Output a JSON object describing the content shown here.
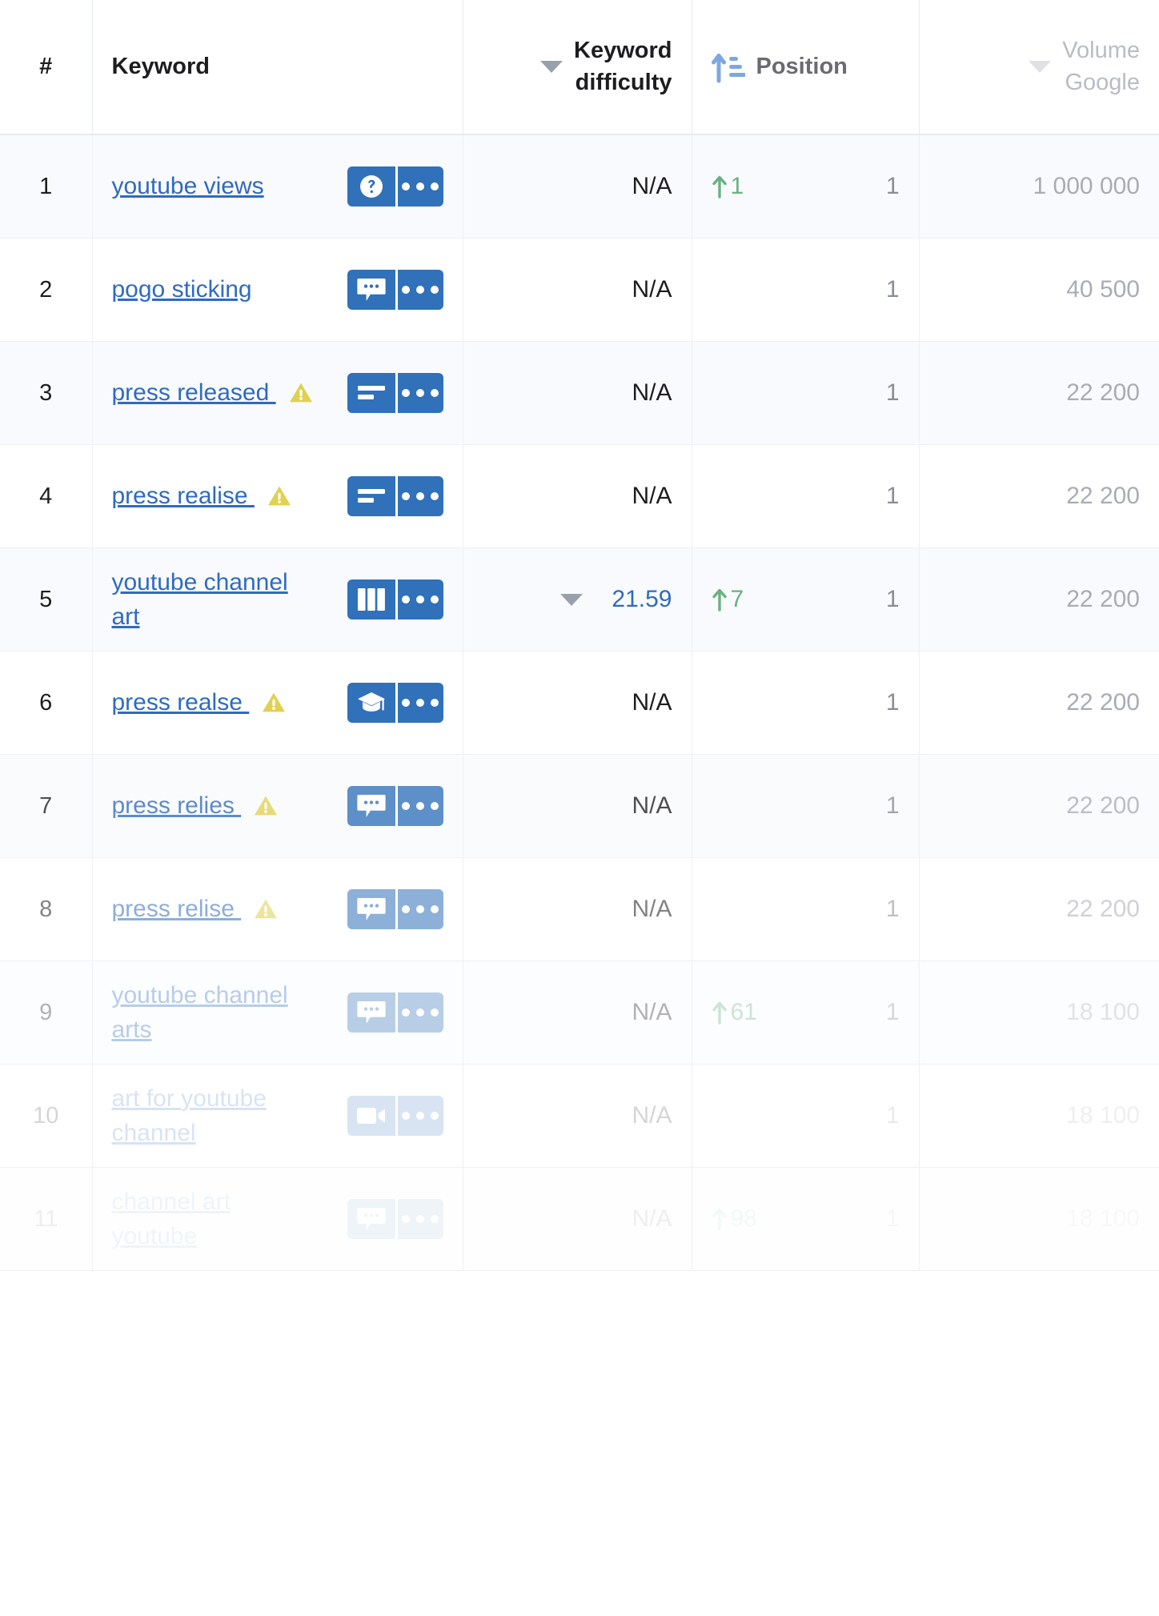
{
  "header": {
    "num_label": "#",
    "keyword_label": "Keyword",
    "kd_label_line1": "Keyword",
    "kd_label_line2": "difficulty",
    "position_label": "Position",
    "volume_label_line1": "Volume",
    "volume_label_line2": "Google",
    "kd_sort_icon": "caret-down-icon",
    "position_sort_icon": "sort-ascending-icon",
    "volume_sort_icon": "caret-down-icon"
  },
  "colors": {
    "link_blue": "#2f6bbf",
    "pill_blue": "#3071b9",
    "warning_yellow": "#e0d152",
    "up_green": "#6ab17f",
    "muted_gray": "#a9acb4",
    "row_alt": "#f9fafd",
    "border": "#eef0f6"
  },
  "rows": [
    {
      "num": "1",
      "keyword": "youtube views",
      "has_warning": false,
      "icon": "question-mark-icon",
      "menu_icon": "ellipsis-icon",
      "difficulty": "N/A",
      "difficulty_has_caret": false,
      "position_delta": "1",
      "position_delta_icon": "arrow-up-icon",
      "position": "1",
      "volume": "1 000 000"
    },
    {
      "num": "2",
      "keyword": "pogo sticking",
      "has_warning": false,
      "icon": "chat-bubble-icon",
      "menu_icon": "ellipsis-icon",
      "difficulty": "N/A",
      "difficulty_has_caret": false,
      "position_delta": "",
      "position_delta_icon": "",
      "position": "1",
      "volume": "40 500"
    },
    {
      "num": "3",
      "keyword": "press released",
      "has_warning": true,
      "icon": "text-lines-icon",
      "menu_icon": "ellipsis-icon",
      "difficulty": "N/A",
      "difficulty_has_caret": false,
      "position_delta": "",
      "position_delta_icon": "",
      "position": "1",
      "volume": "22 200"
    },
    {
      "num": "4",
      "keyword": "press realise",
      "has_warning": true,
      "icon": "text-lines-icon",
      "menu_icon": "ellipsis-icon",
      "difficulty": "N/A",
      "difficulty_has_caret": false,
      "position_delta": "",
      "position_delta_icon": "",
      "position": "1",
      "volume": "22 200"
    },
    {
      "num": "5",
      "keyword": "youtube channel art",
      "has_warning": false,
      "icon": "columns-icon",
      "menu_icon": "ellipsis-icon",
      "difficulty": "21.59",
      "difficulty_has_caret": true,
      "position_delta": "7",
      "position_delta_icon": "arrow-up-icon",
      "position": "1",
      "volume": "22 200"
    },
    {
      "num": "6",
      "keyword": "press realse",
      "has_warning": true,
      "icon": "graduation-cap-icon",
      "menu_icon": "ellipsis-icon",
      "difficulty": "N/A",
      "difficulty_has_caret": false,
      "position_delta": "",
      "position_delta_icon": "",
      "position": "1",
      "volume": "22 200"
    },
    {
      "num": "7",
      "keyword": "press relies",
      "has_warning": true,
      "icon": "chat-bubble-icon",
      "menu_icon": "ellipsis-icon",
      "difficulty": "N/A",
      "difficulty_has_caret": false,
      "position_delta": "",
      "position_delta_icon": "",
      "position": "1",
      "volume": "22 200"
    },
    {
      "num": "8",
      "keyword": "press relise",
      "has_warning": true,
      "icon": "chat-bubble-icon",
      "menu_icon": "ellipsis-icon",
      "difficulty": "N/A",
      "difficulty_has_caret": false,
      "position_delta": "",
      "position_delta_icon": "",
      "position": "1",
      "volume": "22 200"
    },
    {
      "num": "9",
      "keyword": "youtube channel arts",
      "has_warning": false,
      "icon": "chat-bubble-icon",
      "menu_icon": "ellipsis-icon",
      "difficulty": "N/A",
      "difficulty_has_caret": false,
      "position_delta": "61",
      "position_delta_icon": "arrow-up-icon",
      "position": "1",
      "volume": "18 100"
    },
    {
      "num": "10",
      "keyword": "art for youtube channel",
      "has_warning": false,
      "icon": "video-camera-icon",
      "menu_icon": "ellipsis-icon",
      "difficulty": "N/A",
      "difficulty_has_caret": false,
      "position_delta": "",
      "position_delta_icon": "",
      "position": "1",
      "volume": "18 100"
    },
    {
      "num": "11",
      "keyword": "channel art youtube",
      "has_warning": false,
      "icon": "chat-bubble-icon",
      "menu_icon": "ellipsis-icon",
      "difficulty": "N/A",
      "difficulty_has_caret": false,
      "position_delta": "98",
      "position_delta_icon": "arrow-up-icon",
      "position": "1",
      "volume": "18 100"
    }
  ]
}
